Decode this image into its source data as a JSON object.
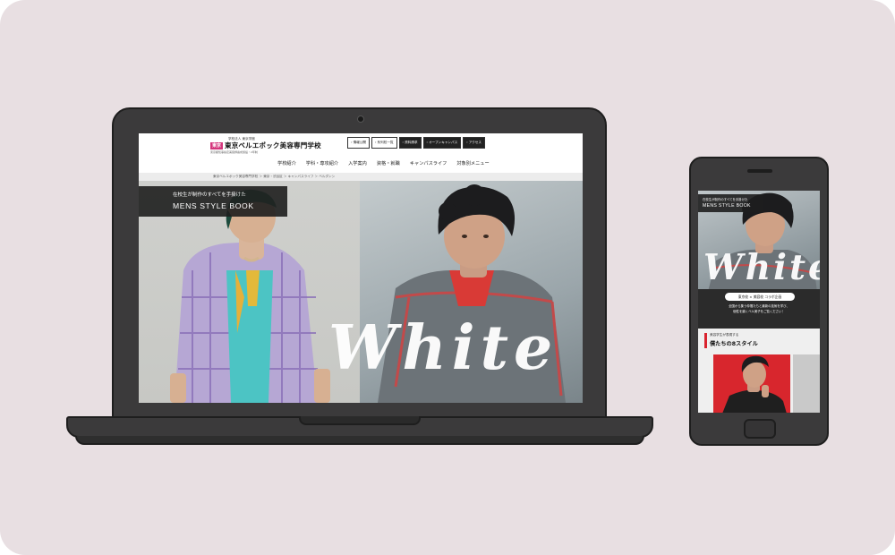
{
  "laptop": {
    "site": {
      "logo_small": "学校法人 東京学館",
      "logo_badge": "東京",
      "logo_text": "東京ベルエポック美容専門学校",
      "logo_sub": "東京都知事指定美容師養成施設・2年制",
      "header_buttons": [
        {
          "label": "› 情報公開",
          "style": "white"
        },
        {
          "label": "› 系列校一覧",
          "style": "white"
        },
        {
          "label": "› 資料請求",
          "style": "dark"
        },
        {
          "label": "› オープンキャンパス",
          "style": "dark"
        },
        {
          "label": "› アクセス",
          "style": "dark"
        }
      ],
      "nav": [
        "学校紹介",
        "学科・専攻紹介",
        "入学案内",
        "資格・就職",
        "キャンパスライフ",
        "対象別メニュー"
      ],
      "breadcrumb": "東京ベルエポック美容専門学校 ＞ 東京・渋谷区 ＞ キャンパスライフ ＞ ベルダンシ"
    },
    "hero": {
      "caption_sub": "在校生が制作のすべてを手掛けた",
      "caption_title": "MENS STYLE BOOK",
      "word": "White"
    }
  },
  "phone": {
    "hero": {
      "caption_sub": "在校生が制作のすべてを手掛けた",
      "caption_title": "MENS STYLE BOOK",
      "word": "White"
    },
    "collab_label": "東京校 × 美容校 コラボ企画",
    "description_lines": [
      "全国から集う仲間たちと最新の技術を学び、",
      "個性を磨くベル美子をご覧ください！"
    ],
    "section": {
      "subtitle": "美容学生が表現する",
      "title": "僕たちの8スタイル"
    }
  },
  "colors": {
    "background": "#e8dfe2",
    "device_body": "#3b3a3b",
    "accent_pink": "#d4357c",
    "accent_red": "#d9232e"
  }
}
